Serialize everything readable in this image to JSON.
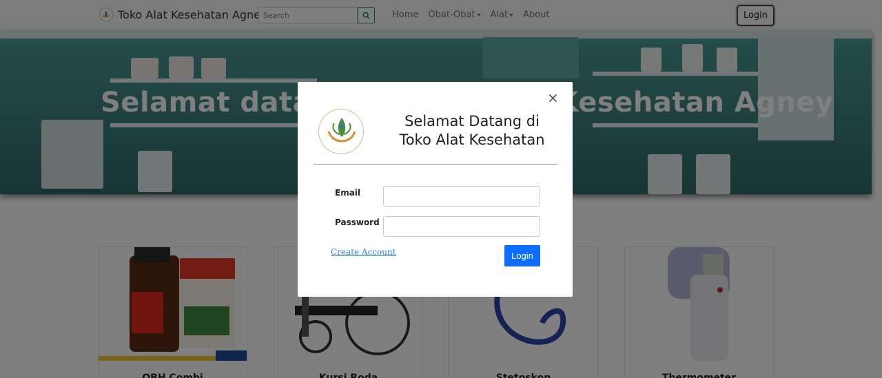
{
  "navbar": {
    "brand": "Toko Alat Kesehatan Agney",
    "search_placeholder": "Search",
    "links": [
      "Home",
      "Obat-Obat",
      "Alat",
      "About"
    ],
    "login_label": "Login"
  },
  "hero": {
    "title": "Selamat datang di Toko Alat Kesehatan Agney"
  },
  "products": [
    {
      "name": "OBH Combi"
    },
    {
      "name": "Kursi Roda"
    },
    {
      "name": "Stetoskop"
    },
    {
      "name": "Thermometer"
    }
  ],
  "modal": {
    "title": "Selamat Datang di Toko Alat Kesehatan",
    "close_label": "×",
    "email_label": "Email",
    "password_label": "Password",
    "create_account_label": "Create Account",
    "login_label": "Login",
    "logo_text": "Toko Alat Kesehatan Agney"
  },
  "colors": {
    "primary": "#0d6efd",
    "success": "#198754",
    "hero": "#3b7f7c"
  }
}
